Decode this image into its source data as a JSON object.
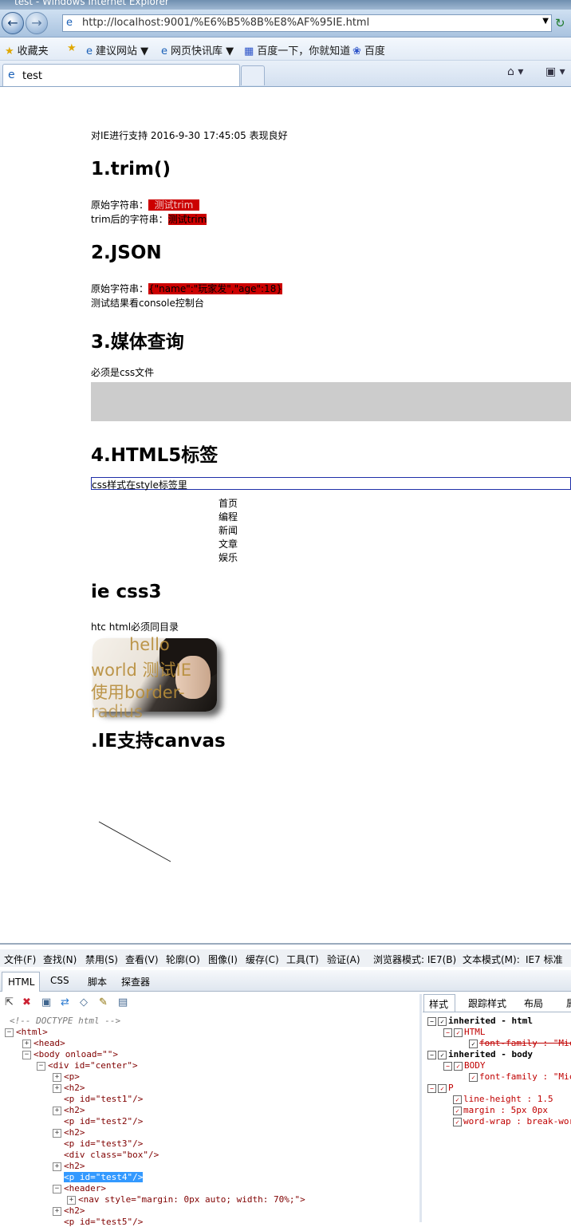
{
  "browser": {
    "window_title": "test - Windows Internet Explorer",
    "url": "http://localhost:9001/%E6%B5%8B%E8%AF%95IE.html",
    "favorites": [
      "收藏夹",
      "建议网站",
      "网页快讯库",
      "百度一下，你就知道",
      "百度"
    ],
    "tab_title": "test"
  },
  "page": {
    "intro": "对IE进行支持 2016-9-30 17:45:05 表现良好",
    "trim_heading": "1.trim()",
    "trim_orig_label": "原始字符串：",
    "trim_orig_value": "  测试trim  ",
    "trim_after_label": "trim后的字符串：",
    "trim_after_value": "测试trim",
    "json_heading": "2.JSON",
    "json_orig_label": "原始字符串：",
    "json_orig_value": "{\"name\":\"玩家发\",\"age\":18}",
    "json_note": "测试结果看console控制台",
    "media_heading": "3.媒体查询",
    "media_note": "必须是css文件",
    "html5_heading": "4.HTML5标签",
    "header_text": "css样式在style标签里",
    "nav_items": [
      "首页",
      "编程",
      "新闻",
      "文章",
      "娱乐"
    ],
    "css3_heading": "ie css3",
    "htc_note": "htc html必须同目录",
    "image_overlay_lines": [
      "hello",
      "world 测试IE",
      "使用border-",
      "radius"
    ],
    "canvas_heading": ".IE支持canvas"
  },
  "devtools": {
    "menu": [
      "文件(F)",
      "查找(N)",
      "禁用(S)",
      "查看(V)",
      "轮廓(O)",
      "图像(I)",
      "缓存(C)",
      "工具(T)",
      "验证(A)",
      "浏览器模式: IE7(B)",
      "文本模式(M):",
      "IE7 标准"
    ],
    "tabs": [
      "HTML",
      "CSS",
      "脚本",
      "探查器"
    ],
    "tree": {
      "doctype": "<!-- DOCTYPE html -->",
      "html": "<html>",
      "head": "<head>",
      "body": "<body onload=\"\">",
      "div": "<div id=\"center\">",
      "p": "<p>",
      "h2": "<h2>",
      "p_test1": "<p id=\"test1\"/>",
      "p_test2": "<p id=\"test2\"/>",
      "p_test3": "<p id=\"test3\"/>",
      "div_box": "<div class=\"box\"/>",
      "p_test4": "<p id=\"test4\"/>",
      "header": "<header>",
      "nav": "<nav style=\"margin: 0px auto; width: 70%;\">",
      "p_test5": "<p id=\"test5\"/>"
    },
    "style_tabs": [
      "样式",
      "跟踪样式",
      "布局",
      "属"
    ],
    "styles": {
      "inherited_html": "inherited - html",
      "html_rule": "HTML",
      "html_font": "font-family : \"Micr",
      "inherited_body": "inherited - body",
      "body_rule": "BODY",
      "body_font": "font-family : \"Micr",
      "p_rule": "P",
      "p_line_height": "line-height : 1.5",
      "p_margin": "margin : 5px 0px",
      "p_word_wrap": "word-wrap : break-word"
    }
  }
}
